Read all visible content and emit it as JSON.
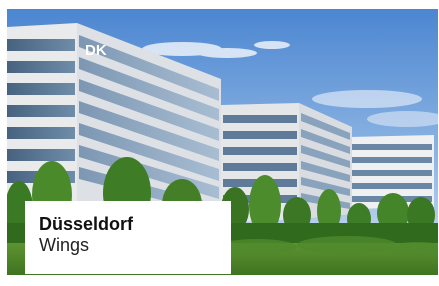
{
  "image": {
    "subject": "modern glass office buildings beside a green park under a blue sky",
    "building_sign": "DK"
  },
  "caption": {
    "city": "Düsseldorf",
    "building": "Wings"
  },
  "colors": {
    "sky_top": "#4f88d0",
    "sky_bottom": "#cfe0f2",
    "facade_glass": "#5b7896",
    "facade_band": "#e6e8ea",
    "foliage": "#3f7f2a",
    "lawn": "#6fa23a",
    "caption_bg": "#ffffff",
    "caption_text": "#111111"
  }
}
